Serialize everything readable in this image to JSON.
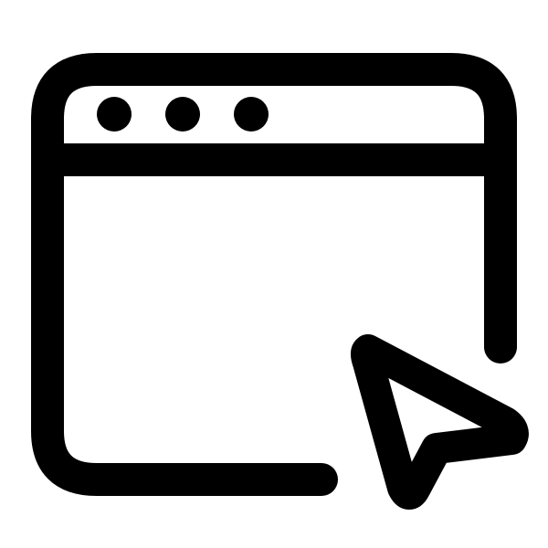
{
  "icon": {
    "name": "browser-window-cursor-icon",
    "parts": [
      "browser-window-icon",
      "window-dot-icon",
      "cursor-arrow-icon"
    ]
  },
  "colors": {
    "stroke": "#000000",
    "background": "#ffffff"
  }
}
